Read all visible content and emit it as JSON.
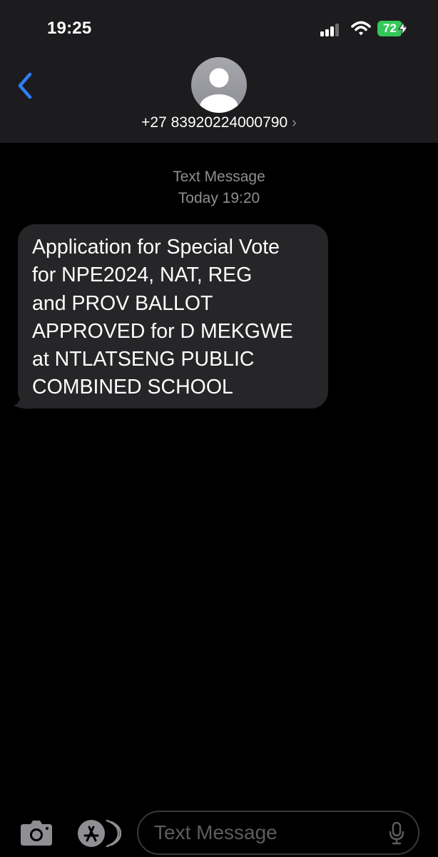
{
  "status_bar": {
    "time": "19:25",
    "battery": "72",
    "battery_color": "#34c759",
    "icons": [
      "cellular-signal-icon",
      "wifi-icon",
      "battery-icon",
      "charging-bolt-icon"
    ]
  },
  "header": {
    "back_icon": "chevron-left-icon",
    "avatar_icon": "person-silhouette-icon",
    "contact": "+27 83920224000790",
    "contact_chevron": "›"
  },
  "conversation": {
    "service_label": "Text Message",
    "timestamp": "Today 19:20",
    "messages": [
      {
        "direction": "incoming",
        "lines": [
          "Application for Special Vote",
          "for NPE2024, NAT, REG",
          "and PROV BALLOT",
          "APPROVED for D MEKGWE",
          "at NTLATSENG PUBLIC",
          "COMBINED SCHOOL"
        ]
      }
    ]
  },
  "composer": {
    "camera_icon": "camera-icon",
    "apps_icon": "app-store-icon",
    "placeholder": "Text Message",
    "mic_icon": "microphone-icon"
  },
  "colors": {
    "accent": "#2f7ef6",
    "header_bg": "#1c1c1e",
    "bubble_bg": "#262628",
    "secondary_text": "#8e8e93"
  }
}
